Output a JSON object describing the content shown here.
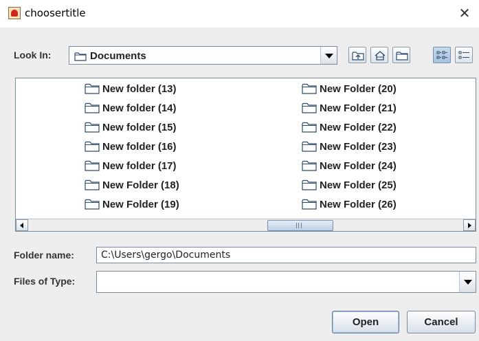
{
  "window": {
    "title": "choosertitle",
    "close_glyph": "✕"
  },
  "look_in": {
    "label": "Look In:",
    "mnemonic": "L",
    "selected": "Documents"
  },
  "toolbar": {
    "buttons": [
      {
        "name": "up-one-level",
        "icon": "folder-up-icon"
      },
      {
        "name": "home",
        "icon": "home-icon"
      },
      {
        "name": "new-folder",
        "icon": "new-folder-icon"
      },
      {
        "name": "list-view",
        "icon": "list-view-icon",
        "active": true
      },
      {
        "name": "details-view",
        "icon": "details-view-icon"
      }
    ]
  },
  "files": {
    "column1": [
      "New folder (13)",
      "New folder (14)",
      "New folder (15)",
      "New folder (16)",
      "New folder (17)",
      "New Folder (18)",
      "New Folder (19)"
    ],
    "column2": [
      "New Folder (20)",
      "New Folder (21)",
      "New Folder (22)",
      "New Folder (23)",
      "New Folder (24)",
      "New Folder (25)",
      "New Folder (26)"
    ]
  },
  "folder_name": {
    "label": "Folder name:",
    "value": "C:\\Users\\gergo\\Documents"
  },
  "files_of_type": {
    "label": "Files of Type:",
    "selected": ""
  },
  "buttons": {
    "open": "Open",
    "cancel": "Cancel"
  },
  "colors": {
    "background": "#eeeeee",
    "border": "#7a8a99",
    "accent": "#a8c2dc"
  }
}
